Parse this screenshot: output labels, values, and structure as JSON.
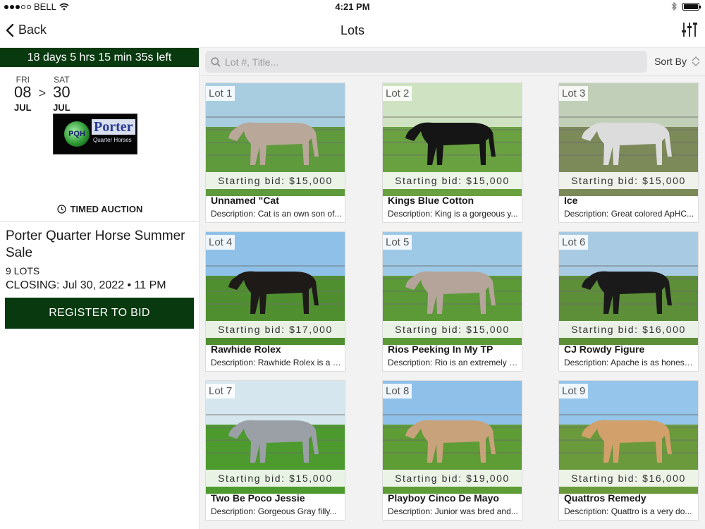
{
  "status": {
    "carrier": "BELL",
    "time": "4:21 PM"
  },
  "nav": {
    "back_label": "Back",
    "title": "Lots"
  },
  "auction": {
    "timer": "18 days 5 hrs 15 min 35s left",
    "start": {
      "dow": "FRI",
      "day": "08",
      "month": "JUL"
    },
    "end": {
      "dow": "SAT",
      "day": "30",
      "month": "JUL"
    },
    "separator": ">",
    "logo_badge": "PQH",
    "logo_word": "Porter",
    "logo_sub": "Quarter Horses",
    "type": "TIMED AUCTION",
    "title": "Porter Quarter Horse Summer Sale",
    "lots_count": "9 LOTS",
    "closing": "CLOSING: Jul 30, 2022 • 11 PM",
    "register_label": "REGISTER TO BID"
  },
  "search": {
    "placeholder": "Lot #, Title..."
  },
  "sort_label": "Sort By",
  "lots": [
    {
      "label": "Lot 1",
      "bid": "Starting bid: $15,000",
      "name": "Unnamed \"Cat",
      "desc": "Description: Cat is an own son of...",
      "sky": "#a9cde0",
      "ground": "#5f9a3c",
      "horse": "#b9a79a"
    },
    {
      "label": "Lot 2",
      "bid": "Starting bid: $15,000",
      "name": "Kings Blue Cotton",
      "desc": "Description: King is a gorgeous y...",
      "sky": "#cfe3c2",
      "ground": "#6aa140",
      "horse": "#151515"
    },
    {
      "label": "Lot 3",
      "bid": "Starting bid: $15,000",
      "name": "Ice",
      "desc": "Description: Great colored ApHC...",
      "sky": "#c2cfb8",
      "ground": "#7c8a5a",
      "horse": "#dcdcdc"
    },
    {
      "label": "Lot 4",
      "bid": "Starting bid: $17,000",
      "name": "Rawhide Rolex",
      "desc": "Description: Rawhide Rolex is a s...",
      "sky": "#8fc1e8",
      "ground": "#4f8f2f",
      "horse": "#1e1a18"
    },
    {
      "label": "Lot 5",
      "bid": "Starting bid: $15,000",
      "name": "Rios Peeking In My TP",
      "desc": "Description: Rio is an extremely a...",
      "sky": "#9ec9e6",
      "ground": "#5b9a36",
      "horse": "#b4a49a"
    },
    {
      "label": "Lot 6",
      "bid": "Starting bid: $16,000",
      "name": "CJ Rowdy Figure",
      "desc": "Description: Apache is as honest,...",
      "sky": "#a8cbe3",
      "ground": "#5d8f38",
      "horse": "#1a1a1a"
    },
    {
      "label": "Lot 7",
      "bid": "Starting bid: $15,000",
      "name": "Two Be Poco Jessie",
      "desc": "Description: Gorgeous Gray filly...",
      "sky": "#d6e6ee",
      "ground": "#4d9b2e",
      "horse": "#9ba0a6"
    },
    {
      "label": "Lot 8",
      "bid": "Starting bid: $19,000",
      "name": "Playboy Cinco De Mayo",
      "desc": "Description: Junior was bred and...",
      "sky": "#8fc0ea",
      "ground": "#5e9c35",
      "horse": "#c7a27a"
    },
    {
      "label": "Lot 9",
      "bid": "Starting bid: $16,000",
      "name": "Quattros Remedy",
      "desc": "Description: Quattro is a very do...",
      "sky": "#95c5ea",
      "ground": "#6a9a3c",
      "horse": "#d2a06a"
    }
  ]
}
